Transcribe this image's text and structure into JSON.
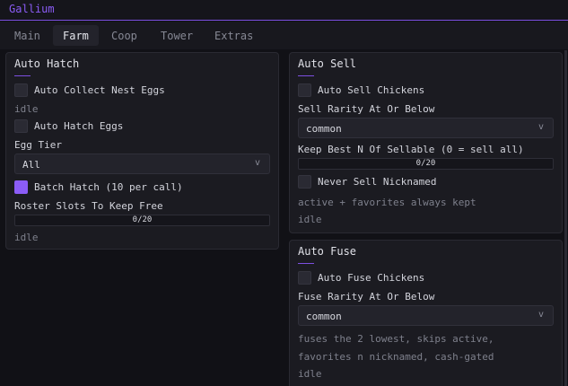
{
  "window": {
    "title": "Gallium"
  },
  "tabs": [
    "Main",
    "Farm",
    "Coop",
    "Tower",
    "Extras"
  ],
  "active_tab": "Farm",
  "auto_hatch": {
    "title": "Auto Hatch",
    "collect_label": "Auto Collect Nest Eggs",
    "collect_checked": false,
    "collect_status": "idle",
    "hatch_label": "Auto Hatch Eggs",
    "hatch_checked": false,
    "egg_tier_label": "Egg Tier",
    "egg_tier_value": "All",
    "batch_label": "Batch Hatch (10 per call)",
    "batch_checked": true,
    "roster_label": "Roster Slots To Keep Free",
    "roster_value": 0,
    "roster_max": 20,
    "roster_text": "0/20",
    "status": "idle"
  },
  "auto_sell": {
    "title": "Auto Sell",
    "sell_label": "Auto Sell Chickens",
    "sell_checked": false,
    "rarity_label": "Sell Rarity At Or Below",
    "rarity_value": "common",
    "keep_label": "Keep Best N Of Sellable (0 = sell all)",
    "keep_value": 0,
    "keep_max": 20,
    "keep_text": "0/20",
    "nick_label": "Never Sell Nicknamed",
    "nick_checked": false,
    "note": "active + favorites always kept",
    "status": "idle"
  },
  "auto_fuse": {
    "title": "Auto Fuse",
    "fuse_label": "Auto Fuse Chickens",
    "fuse_checked": false,
    "rarity_label": "Fuse Rarity At Or Below",
    "rarity_value": "common",
    "note_line1": "fuses the 2 lowest, skips active,",
    "note_line2": "favorites n nicknamed, cash-gated",
    "status": "idle"
  },
  "icons": {
    "dropdown": "chevron-down-icon"
  },
  "colors": {
    "accent": "#8b5cf6",
    "background": "#111116",
    "panel": "#1b1b21"
  }
}
